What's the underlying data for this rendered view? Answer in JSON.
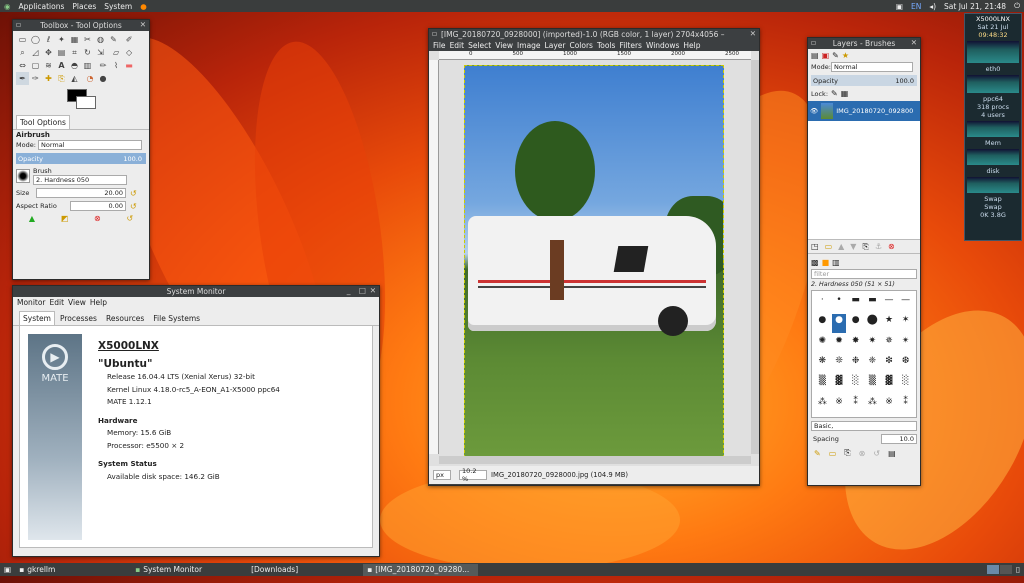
{
  "topbar": {
    "applications": "Applications",
    "places": "Places",
    "system": "System",
    "lang": "EN",
    "clock": "Sat Jul 21, 21:48"
  },
  "taskbar": {
    "items": [
      "gkrellm",
      "System Monitor",
      "[Downloads]",
      "[IMG_20180720_09280..."
    ]
  },
  "gkrellm": {
    "host": "X5000LNX",
    "uptime": "Sat 21 Jul",
    "time": "09:48:32",
    "labels": [
      "eth0",
      "Mem",
      "Swap",
      "disk",
      "ppc64"
    ],
    "stats": [
      "318 procs",
      "4 users"
    ],
    "swap": "Swap",
    "mem_values": "0K 3.8G"
  },
  "toolbox": {
    "title": "Toolbox - Tool Options",
    "tool_options_tab": "Tool Options",
    "tool_name": "Airbrush",
    "mode_label": "Mode:",
    "mode_value": "Normal",
    "opacity_label": "Opacity",
    "opacity_value": "100.0",
    "brush_label": "Brush",
    "brush_name": "2. Hardness 050",
    "size_label": "Size",
    "size_value": "20.00",
    "aspect_label": "Aspect Ratio",
    "aspect_value": "0.00"
  },
  "sysmon": {
    "title": "System Monitor",
    "menu": [
      "Monitor",
      "Edit",
      "View",
      "Help"
    ],
    "tabs": [
      "System",
      "Processes",
      "Resources",
      "File Systems"
    ],
    "logo_text": "MATE",
    "hostname": "X5000LNX",
    "distro": "\"Ubuntu\"",
    "release": "Release 16.04.4 LTS (Xenial Xerus) 32-bit",
    "kernel": "Kernel Linux 4.18.0-rc5_A-EON_A1-X5000 ppc64",
    "mate": "MATE 1.12.1",
    "hardware_title": "Hardware",
    "memory": "Memory:    15.6 GiB",
    "processor": "Processor:    e5500 × 2",
    "status_title": "System Status",
    "disk": "Available disk space:  146.2 GiB"
  },
  "gimp": {
    "title": "[IMG_20180720_0928000] (imported)-1.0 (RGB color, 1 layer) 2704x4056 –",
    "menu": [
      "File",
      "Edit",
      "Select",
      "View",
      "Image",
      "Layer",
      "Colors",
      "Tools",
      "Filters",
      "Windows",
      "Help"
    ],
    "unit": "px",
    "zoom": "10.2 %",
    "status": "IMG_20180720_0928000.jpg (104.9 MB)",
    "ruler_ticks": [
      "0",
      "500",
      "1000",
      "1500",
      "2000",
      "2500"
    ],
    "vruler_ticks": [
      "0",
      "500",
      "1000",
      "1500",
      "2000",
      "2500",
      "3000",
      "3500",
      "4000"
    ]
  },
  "layers": {
    "title": "Layers - Brushes",
    "mode_label": "Mode:",
    "mode_value": "Normal",
    "opacity_label": "Opacity",
    "opacity_value": "100.0",
    "lock_label": "Lock:",
    "layer_name": "IMG_20180720_092800",
    "filter_placeholder": "filter",
    "brush_name": "2. Hardness 050 (51 × 51)",
    "preset": "Basic,",
    "spacing_label": "Spacing",
    "spacing_value": "10.0"
  }
}
